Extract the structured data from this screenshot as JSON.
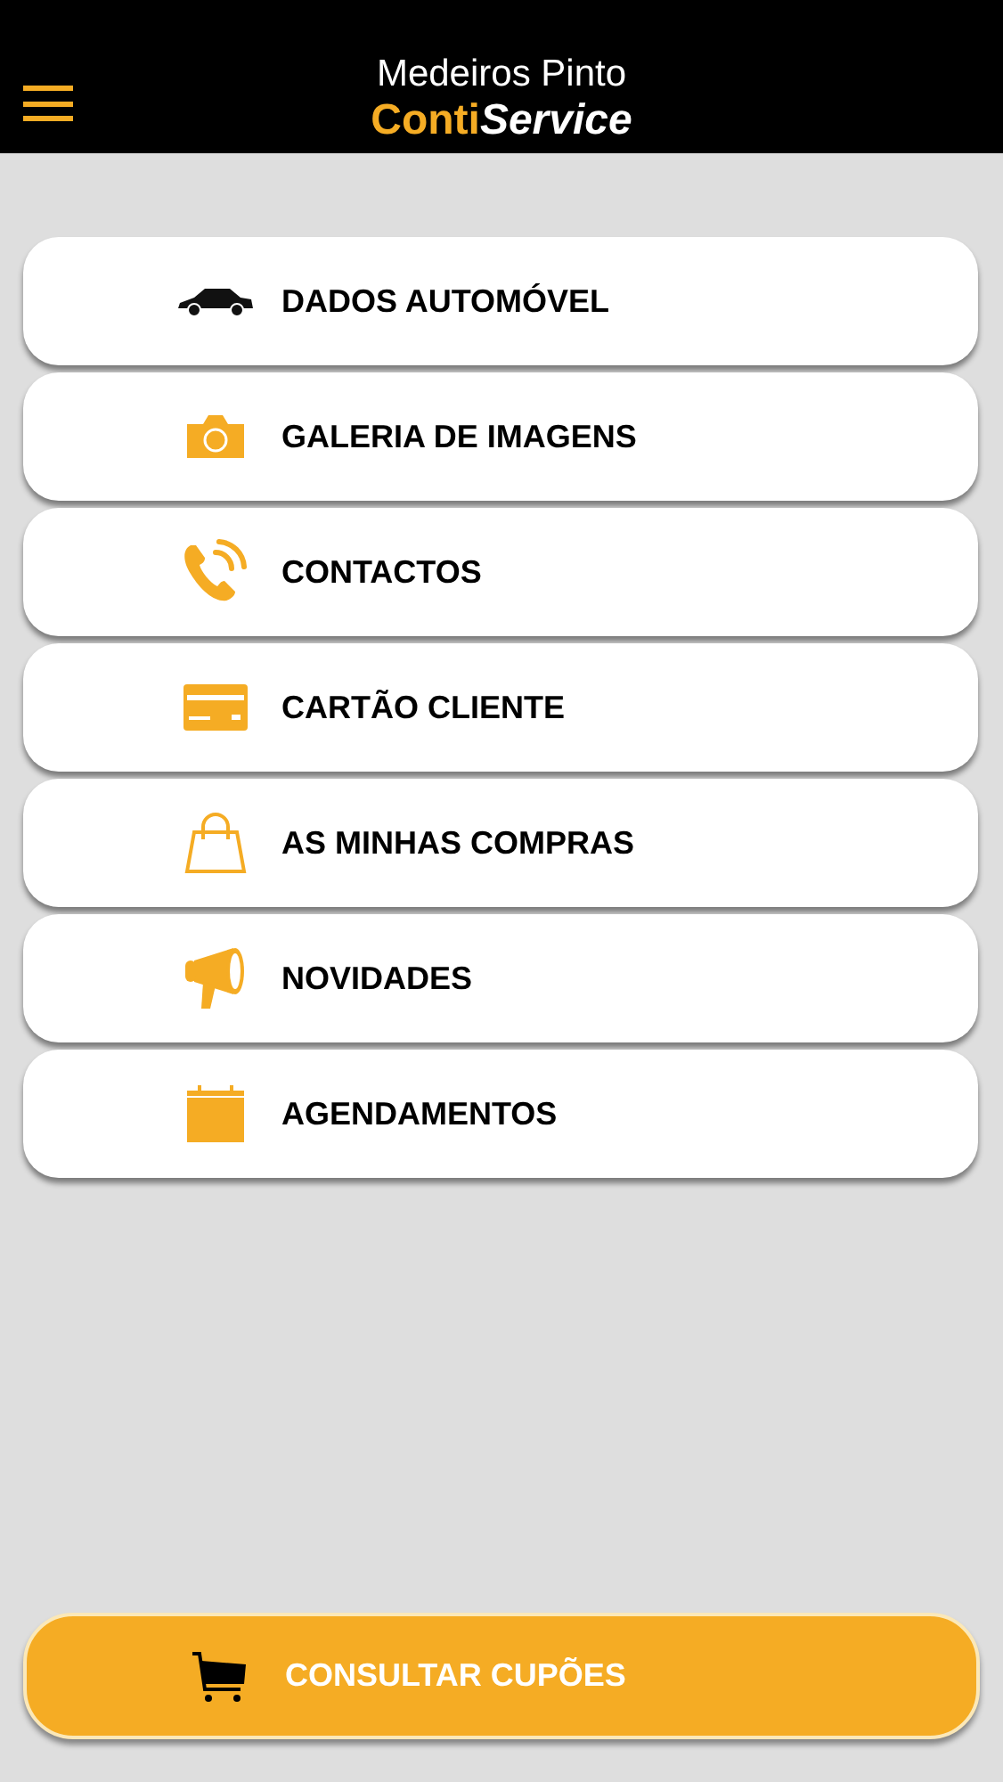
{
  "header": {
    "subtitle": "Medeiros Pinto",
    "logo_first": "Conti",
    "logo_second": "Service"
  },
  "menu": [
    {
      "kind": "car",
      "label": "DADOS AUTOMÓVEL"
    },
    {
      "kind": "camera",
      "label": "GALERIA DE IMAGENS"
    },
    {
      "kind": "phone",
      "label": "CONTACTOS"
    },
    {
      "kind": "card",
      "label": "CARTÃO CLIENTE"
    },
    {
      "kind": "bag",
      "label": "AS MINHAS COMPRAS"
    },
    {
      "kind": "megaphone",
      "label": "NOVIDADES"
    },
    {
      "kind": "calendar",
      "label": "AGENDAMENTOS"
    }
  ],
  "footer_button": {
    "label": "CONSULTAR CUPÕES"
  }
}
